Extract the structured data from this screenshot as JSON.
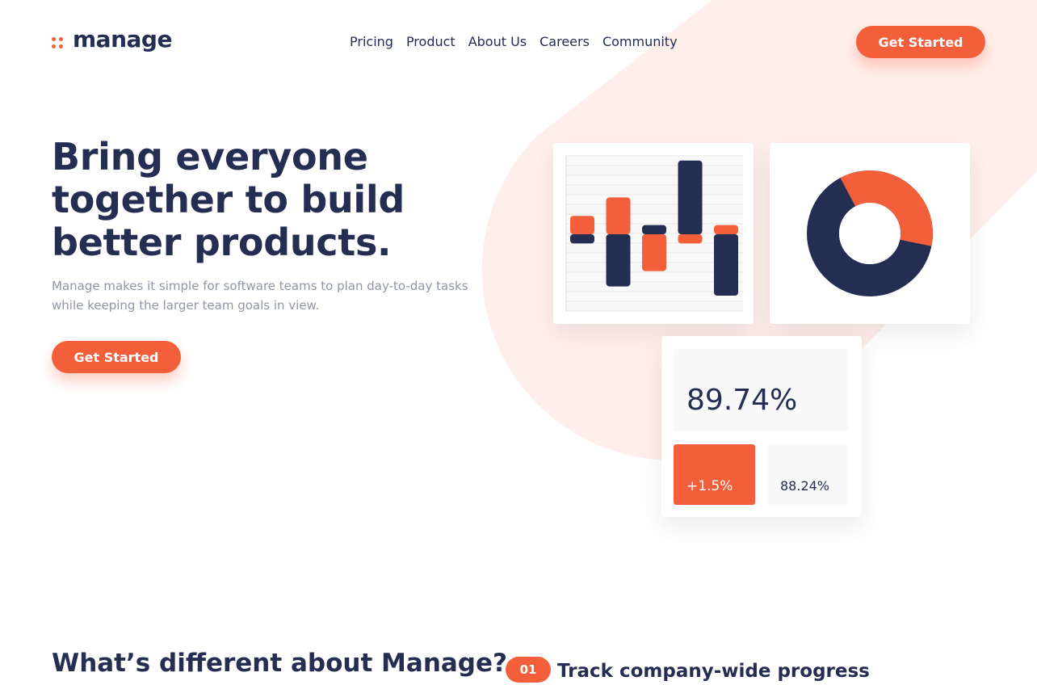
{
  "brand": {
    "logo_text": "manage",
    "accent_color": "#f25f3a",
    "dark_color": "#242d52",
    "muted_color": "#9095a7",
    "tint_color": "#ffefeb"
  },
  "nav": {
    "items": [
      "Pricing",
      "Product",
      "About Us",
      "Careers",
      "Community"
    ],
    "cta_label": "Get Started"
  },
  "hero": {
    "title_lines": [
      "Bring everyone",
      "together to build",
      "better products."
    ],
    "subtitle_lines": [
      "Manage makes it simple for software teams to plan day-to-day tasks",
      "while keeping the larger team goals in view."
    ],
    "cta_label": "Get Started"
  },
  "dashboard": {
    "bars": {
      "columns": [
        {
          "up": 0.6,
          "down": 0.0,
          "offset": 0.0,
          "top_color": "#f25f3a",
          "bottom_color": "#242d52"
        },
        {
          "up": 1.2,
          "down": 1.7,
          "offset": 0.0,
          "top_color": "#f25f3a",
          "bottom_color": "#242d52"
        },
        {
          "up": 0.0,
          "down": 1.2,
          "offset": 0.0,
          "top_color": "#242d52",
          "bottom_color": "#f25f3a"
        },
        {
          "up": 2.4,
          "down": 0.0,
          "offset": 0.0,
          "top_color": "#242d52",
          "bottom_color": "#f25f3a"
        },
        {
          "up": 0.0,
          "down": 2.0,
          "offset": 0.0,
          "top_color": "#f25f3a",
          "bottom_color": "#242d52"
        }
      ]
    },
    "donut": {
      "share_orange": 0.36,
      "colors": [
        "#f25f3a",
        "#242d52"
      ]
    },
    "stats": {
      "main_value": "89.74%",
      "change_value": "+1.5%",
      "secondary_value": "88.24%"
    }
  },
  "section": {
    "title": "What’s different about Manage?",
    "feature_number": "01",
    "feature_title": "Track company-wide progress"
  }
}
